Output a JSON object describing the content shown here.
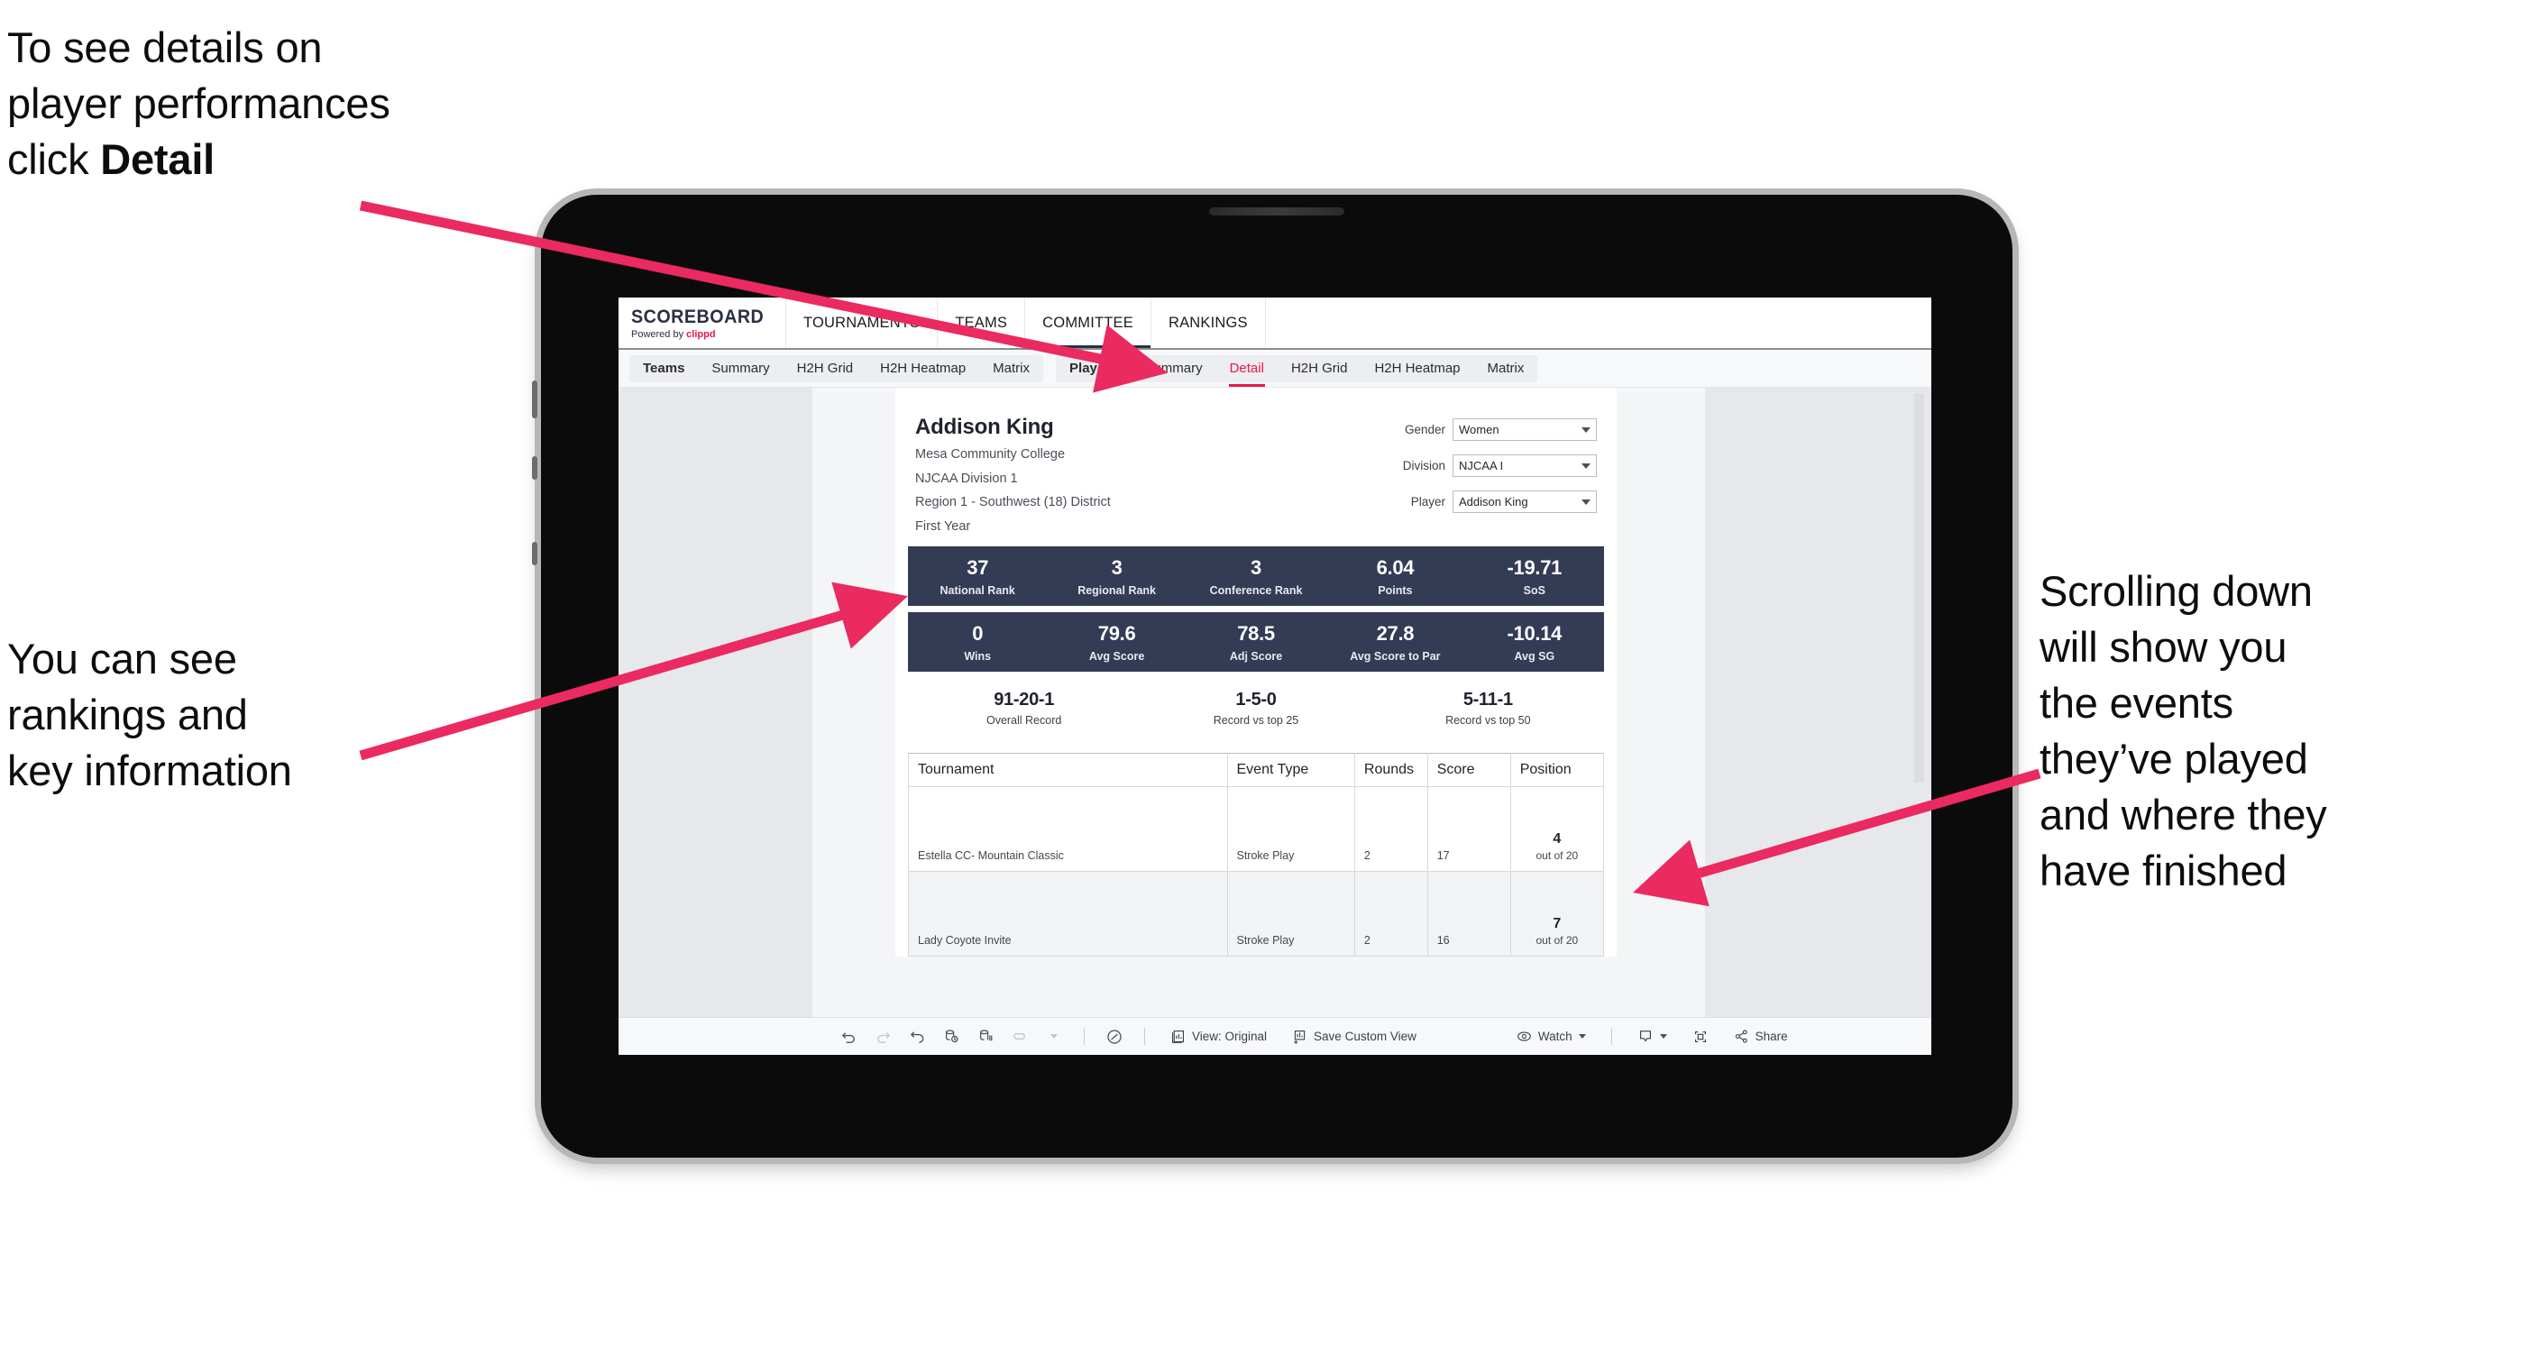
{
  "annotations": [
    {
      "id": "annot-detail",
      "text_before": "To see details on\nplayer performances\nclick ",
      "bold": "Detail",
      "text_after": ""
    },
    {
      "id": "annot-rank",
      "text": "You can see\nrankings and\nkey information"
    },
    {
      "id": "annot-scroll",
      "text": "Scrolling down\nwill show you\nthe events\nthey’ve played\nand where they\nhave finished"
    }
  ],
  "app": {
    "brand": {
      "name": "SCOREBOARD",
      "powered_prefix": "Powered by ",
      "powered_brand": "clippd"
    },
    "topnav": [
      {
        "label": "TOURNAMENTS",
        "active": false
      },
      {
        "label": "TEAMS",
        "active": false
      },
      {
        "label": "COMMITTEE",
        "active": false
      },
      {
        "label": "RANKINGS",
        "active": true
      }
    ],
    "subnav": [
      {
        "group": "teams",
        "items": [
          {
            "label": "Teams",
            "head": true,
            "active": false
          },
          {
            "label": "Summary",
            "head": false,
            "active": false
          },
          {
            "label": "H2H Grid",
            "head": false,
            "active": false
          },
          {
            "label": "H2H Heatmap",
            "head": false,
            "active": false
          },
          {
            "label": "Matrix",
            "head": false,
            "active": false
          }
        ]
      },
      {
        "group": "players",
        "items": [
          {
            "label": "Players",
            "head": true,
            "active": false
          },
          {
            "label": "Summary",
            "head": false,
            "active": false
          },
          {
            "label": "Detail",
            "head": false,
            "active": true
          },
          {
            "label": "H2H Grid",
            "head": false,
            "active": false
          },
          {
            "label": "H2H Heatmap",
            "head": false,
            "active": false
          },
          {
            "label": "Matrix",
            "head": false,
            "active": false
          }
        ]
      }
    ]
  },
  "player": {
    "name": "Addison King",
    "school": "Mesa Community College",
    "division": "NJCAA Division 1",
    "region": "Region 1 - Southwest (18) District",
    "year": "First Year"
  },
  "filters": [
    {
      "label": "Gender",
      "value": "Women"
    },
    {
      "label": "Division",
      "value": "NJCAA I"
    },
    {
      "label": "Player",
      "value": "Addison King"
    }
  ],
  "stats_row1": [
    {
      "value": "37",
      "label": "National Rank"
    },
    {
      "value": "3",
      "label": "Regional Rank"
    },
    {
      "value": "3",
      "label": "Conference Rank"
    },
    {
      "value": "6.04",
      "label": "Points"
    },
    {
      "value": "-19.71",
      "label": "SoS"
    }
  ],
  "stats_row2": [
    {
      "value": "0",
      "label": "Wins"
    },
    {
      "value": "79.6",
      "label": "Avg Score"
    },
    {
      "value": "78.5",
      "label": "Adj Score"
    },
    {
      "value": "27.8",
      "label": "Avg Score to Par"
    },
    {
      "value": "-10.14",
      "label": "Avg SG"
    }
  ],
  "records": [
    {
      "value": "91-20-1",
      "label": "Overall Record"
    },
    {
      "value": "1-5-0",
      "label": "Record vs top 25"
    },
    {
      "value": "5-11-1",
      "label": "Record vs top 50"
    }
  ],
  "events_table": {
    "columns": [
      "Tournament",
      "Event Type",
      "Rounds",
      "Score",
      "Position"
    ],
    "rows": [
      {
        "tournament": "Estella CC- Mountain Classic",
        "event_type": "Stroke Play",
        "rounds": "2",
        "score": "17",
        "position": "4",
        "position_sub": "out of 20"
      },
      {
        "tournament": "Lady Coyote Invite",
        "event_type": "Stroke Play",
        "rounds": "2",
        "score": "16",
        "position": "7",
        "position_sub": "out of 20"
      }
    ]
  },
  "toolbar": {
    "view_label": "View: Original",
    "save_label": "Save Custom View",
    "watch_label": "Watch",
    "share_label": "Share"
  },
  "colors": {
    "accent_pink": "#e8174c",
    "stat_navy": "#333b55",
    "arrow_pink": "#ea2a60"
  }
}
